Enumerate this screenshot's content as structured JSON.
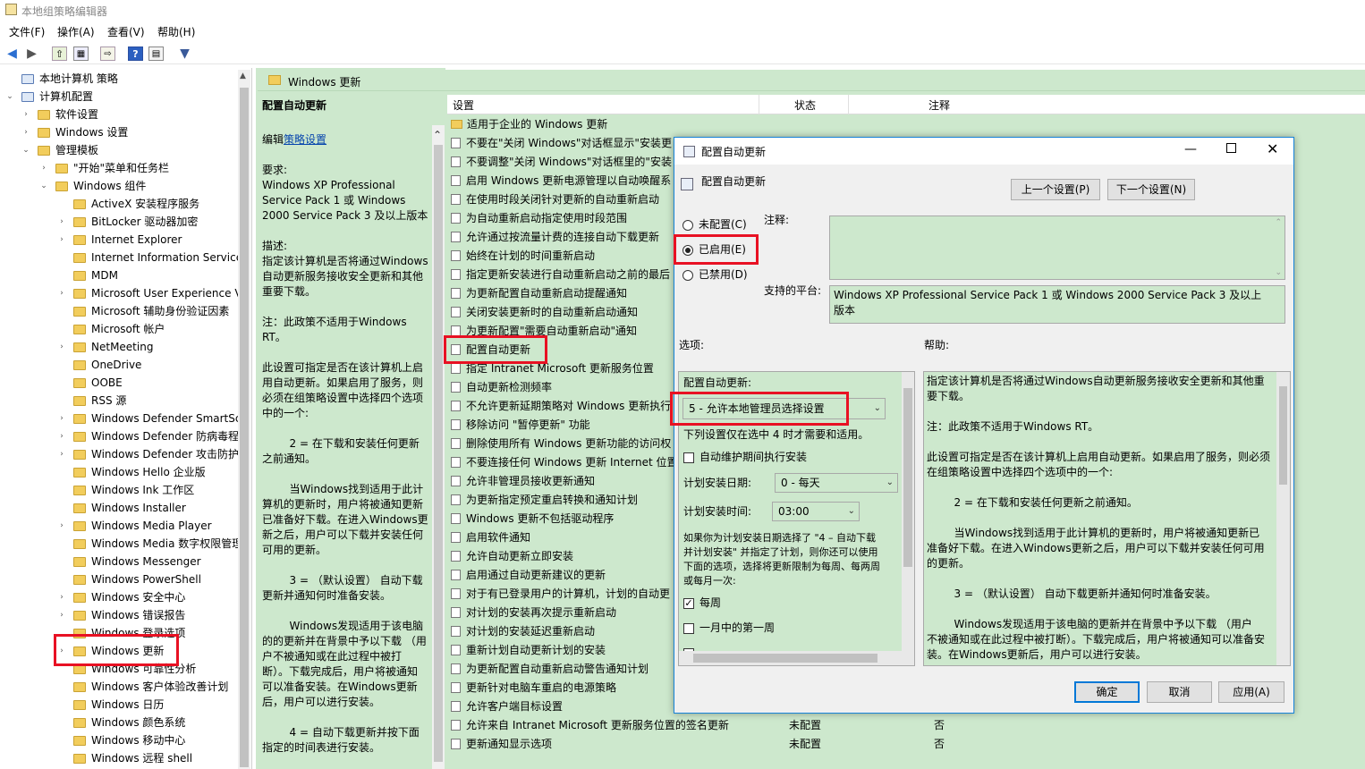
{
  "window": {
    "title": "本地组策略编辑器"
  },
  "menu": [
    "文件(F)",
    "操作(A)",
    "查看(V)",
    "帮助(H)"
  ],
  "tree": [
    {
      "label": "本地计算机 策略",
      "indent": 0,
      "arrow": ""
    },
    {
      "label": "计算机配置",
      "indent": 1,
      "arrow": "v"
    },
    {
      "label": "软件设置",
      "indent": 2,
      "arrow": ">"
    },
    {
      "label": "Windows 设置",
      "indent": 2,
      "arrow": ">"
    },
    {
      "label": "管理模板",
      "indent": 2,
      "arrow": "v"
    },
    {
      "label": "\"开始\"菜单和任务栏",
      "indent": 3,
      "arrow": ">"
    },
    {
      "label": "Windows 组件",
      "indent": 3,
      "arrow": "v"
    },
    {
      "label": "ActiveX 安装程序服务",
      "indent": 4,
      "arrow": ""
    },
    {
      "label": "BitLocker 驱动器加密",
      "indent": 4,
      "arrow": ">"
    },
    {
      "label": "Internet Explorer",
      "indent": 4,
      "arrow": ">"
    },
    {
      "label": "Internet Information Service",
      "indent": 4,
      "arrow": ""
    },
    {
      "label": "MDM",
      "indent": 4,
      "arrow": ""
    },
    {
      "label": "Microsoft User Experience V",
      "indent": 4,
      "arrow": ">"
    },
    {
      "label": "Microsoft 辅助身份验证因素",
      "indent": 4,
      "arrow": ""
    },
    {
      "label": "Microsoft 帐户",
      "indent": 4,
      "arrow": ""
    },
    {
      "label": "NetMeeting",
      "indent": 4,
      "arrow": ">"
    },
    {
      "label": "OneDrive",
      "indent": 4,
      "arrow": ""
    },
    {
      "label": "OOBE",
      "indent": 4,
      "arrow": ""
    },
    {
      "label": "RSS 源",
      "indent": 4,
      "arrow": ""
    },
    {
      "label": "Windows Defender SmartSc",
      "indent": 4,
      "arrow": ">"
    },
    {
      "label": "Windows Defender 防病毒程",
      "indent": 4,
      "arrow": ">"
    },
    {
      "label": "Windows Defender 攻击防护",
      "indent": 4,
      "arrow": ">"
    },
    {
      "label": "Windows Hello 企业版",
      "indent": 4,
      "arrow": ""
    },
    {
      "label": "Windows Ink 工作区",
      "indent": 4,
      "arrow": ""
    },
    {
      "label": "Windows Installer",
      "indent": 4,
      "arrow": ""
    },
    {
      "label": "Windows Media Player",
      "indent": 4,
      "arrow": ">"
    },
    {
      "label": "Windows Media 数字权限管理",
      "indent": 4,
      "arrow": ""
    },
    {
      "label": "Windows Messenger",
      "indent": 4,
      "arrow": ""
    },
    {
      "label": "Windows PowerShell",
      "indent": 4,
      "arrow": ""
    },
    {
      "label": "Windows 安全中心",
      "indent": 4,
      "arrow": ">"
    },
    {
      "label": "Windows 错误报告",
      "indent": 4,
      "arrow": ">"
    },
    {
      "label": "Windows 登录选项",
      "indent": 4,
      "arrow": ""
    },
    {
      "label": "Windows 更新",
      "indent": 4,
      "arrow": ">"
    },
    {
      "label": "Windows 可靠性分析",
      "indent": 4,
      "arrow": ""
    },
    {
      "label": "Windows 客户体验改善计划",
      "indent": 4,
      "arrow": ""
    },
    {
      "label": "Windows 日历",
      "indent": 4,
      "arrow": ""
    },
    {
      "label": "Windows 颜色系统",
      "indent": 4,
      "arrow": ""
    },
    {
      "label": "Windows 移动中心",
      "indent": 4,
      "arrow": ""
    },
    {
      "label": "Windows 远程 shell",
      "indent": 4,
      "arrow": ""
    }
  ],
  "header": {
    "folder": "Windows 更新"
  },
  "desc": {
    "title": "配置自动更新",
    "edit_prefix": "编辑",
    "edit_link": "策略设置",
    "lines": [
      "要求:",
      "Windows XP Professional",
      "Service Pack 1 或 Windows",
      "2000 Service Pack 3 及以上版本",
      "",
      "描述:",
      "指定该计算机是否将通过Windows",
      "自动更新服务接收安全更新和其他",
      "重要下载。",
      "",
      "注：此政策不适用于Windows",
      "RT。",
      "",
      "此设置可指定是否在该计算机上启",
      "用自动更新。如果启用了服务，则",
      "必须在组策略设置中选择四个选项",
      "中的一个:",
      "",
      "        2 = 在下载和安装任何更新",
      "之前通知。",
      "",
      "        当Windows找到适用于此计",
      "算机的更新时，用户将被通知更新",
      "已准备好下载。在进入Windows更",
      "新之后，用户可以下载并安装任何",
      "可用的更新。",
      "",
      "        3 = （默认设置） 自动下载",
      "更新并通知何时准备安装。",
      "",
      "        Windows发现适用于该电脑",
      "的的更新并在背景中予以下载 （用",
      "户不被通知或在此过程中被打",
      "断）。下载完成后，用户将被通知",
      "可以准备安装。在Windows更新",
      "后，用户可以进行安装。",
      "",
      "        4 = 自动下载更新并按下面",
      "指定的时间表进行安装。"
    ]
  },
  "list": {
    "columns": [
      "设置",
      "状态",
      "注释"
    ],
    "rows": [
      {
        "name": "适用于企业的 Windows 更新",
        "folder": true
      },
      {
        "name": "不要在\"关闭 Windows\"对话框显示\"安装更"
      },
      {
        "name": "不要调整\"关闭 Windows\"对话框里的\"安装"
      },
      {
        "name": "启用 Windows 更新电源管理以自动唤醒系"
      },
      {
        "name": "在使用时段关闭针对更新的自动重新启动"
      },
      {
        "name": "为自动重新启动指定使用时段范围"
      },
      {
        "name": "允许通过按流量计费的连接自动下载更新"
      },
      {
        "name": "始终在计划的时间重新启动"
      },
      {
        "name": "指定更新安装进行自动重新启动之前的最后"
      },
      {
        "name": "为更新配置自动重新启动提醒通知"
      },
      {
        "name": "关闭安装更新时的自动重新启动通知"
      },
      {
        "name": "为更新配置\"需要自动重新启动\"通知"
      },
      {
        "name": "配置自动更新"
      },
      {
        "name": "指定 Intranet Microsoft 更新服务位置"
      },
      {
        "name": "自动更新检测频率"
      },
      {
        "name": "不允许更新延期策略对 Windows 更新执行"
      },
      {
        "name": "移除访问 \"暂停更新\" 功能"
      },
      {
        "name": "删除使用所有 Windows 更新功能的访问权"
      },
      {
        "name": "不要连接任何 Windows 更新 Internet 位置"
      },
      {
        "name": "允许非管理员接收更新通知"
      },
      {
        "name": "为更新指定预定重启转换和通知计划"
      },
      {
        "name": "Windows 更新不包括驱动程序"
      },
      {
        "name": "启用软件通知"
      },
      {
        "name": "允许自动更新立即安装"
      },
      {
        "name": "启用通过自动更新建议的更新"
      },
      {
        "name": "对于有已登录用户的计算机，计划的自动更"
      },
      {
        "name": "对计划的安装再次提示重新启动"
      },
      {
        "name": "对计划的安装延迟重新启动"
      },
      {
        "name": "重新计划自动更新计划的安装"
      },
      {
        "name": "为更新配置自动重新启动警告通知计划"
      },
      {
        "name": "更新针对电脑车重启的电源策略"
      },
      {
        "name": "允许客户端目标设置"
      },
      {
        "name": "允许来自 Intranet Microsoft 更新服务位置的签名更新",
        "status": "未配置",
        "note": "否"
      },
      {
        "name": "更新通知显示选项",
        "status": "未配置",
        "note": "否"
      }
    ]
  },
  "dialog": {
    "title": "配置自动更新",
    "subtitle": "配置自动更新",
    "prev_button": "上一个设置(P)",
    "next_button": "下一个设置(N)",
    "radio_not_configured": "未配置(C)",
    "radio_enabled": "已启用(E)",
    "radio_disabled": "已禁用(D)",
    "comment_label": "注释:",
    "platform_label": "支持的平台:",
    "platform_text": "Windows XP Professional Service Pack 1 或 Windows 2000 Service Pack 3 及以上版本",
    "options_label": "选项:",
    "help_label": "帮助:",
    "opt_configure_label": "配置自动更新:",
    "opt_configure_value": "5 - 允许本地管理员选择设置",
    "opt_note": "下列设置仅在选中 4 时才需要和适用。",
    "opt_maint_label": "自动维护期间执行安装",
    "opt_day_label": "计划安装日期:",
    "opt_day_value": "0 - 每天",
    "opt_time_label": "计划安装时间:",
    "opt_time_value": "03:00",
    "opt_para": [
      "如果你为计划安装日期选择了 \"4 – 自动下载",
      "并计划安装\" 并指定了计划，则你还可以使用",
      "下面的选项，选择将更新限制为每周、每两周",
      "或每月一次:"
    ],
    "opt_weekly": "每周",
    "opt_firstweek": "一月中的第一周",
    "help_lines": [
      "指定该计算机是否将通过Windows自动更新服务接收安全更新和其他重",
      "要下载。",
      "",
      "注：此政策不适用于Windows RT。",
      "",
      "此设置可指定是否在该计算机上启用自动更新。如果启用了服务，则必须",
      "在组策略设置中选择四个选项中的一个:",
      "",
      "        2 = 在下载和安装任何更新之前通知。",
      "",
      "        当Windows找到适用于此计算机的更新时，用户将被通知更新已",
      "准备好下载。在进入Windows更新之后，用户可以下载并安装任何可用",
      "的更新。",
      "",
      "        3 = （默认设置） 自动下载更新并通知何时准备安装。",
      "",
      "        Windows发现适用于该电脑的更新并在背景中予以下载 （用户",
      "不被通知或在此过程中被打断）。下载完成后，用户将被通知可以准备安",
      "装。在Windows更新后，用户可以进行安装。"
    ],
    "ok": "确定",
    "cancel": "取消",
    "apply": "应用(A)"
  }
}
